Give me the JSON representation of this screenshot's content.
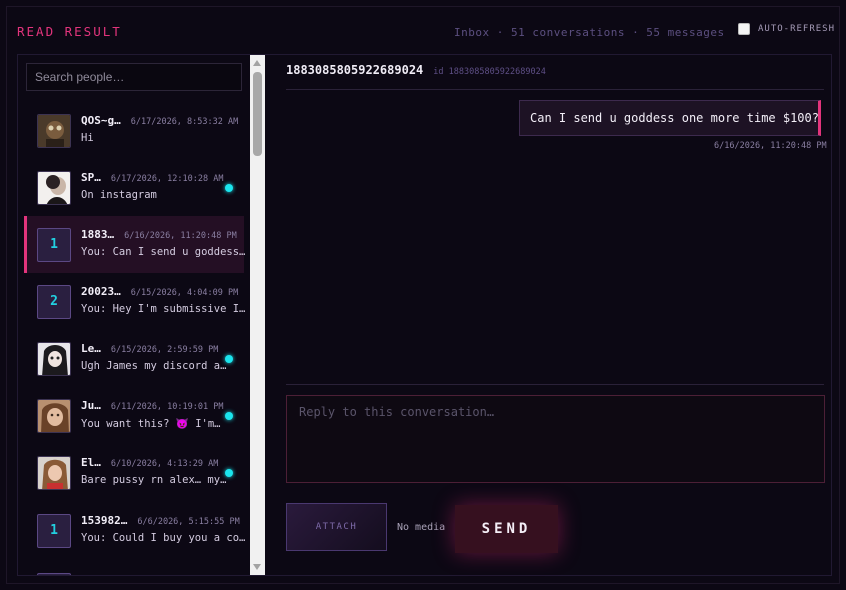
{
  "header": {
    "title": "READ RESULT",
    "stats": "Inbox · 51 conversations · 55 messages",
    "auto_refresh_label": "AUTO-REFRESH",
    "auto_refresh_checked": false
  },
  "sidebar": {
    "search_placeholder": "Search people…",
    "conversations": [
      {
        "name": "QOS~g…",
        "time": "6/17/2026, 8:53:32 AM",
        "preview": "Hi",
        "avatar": "photo",
        "unread": false,
        "active": false
      },
      {
        "name": "SP…",
        "time": "6/17/2026, 12:10:28 AM",
        "preview": "On instagram",
        "avatar": "photo",
        "unread": true,
        "active": false
      },
      {
        "name": "1883…",
        "time": "6/16/2026, 11:20:48 PM",
        "preview": "You: Can I send u goddess…",
        "avatar": "1",
        "unread": false,
        "active": true
      },
      {
        "name": "20023…",
        "time": "6/15/2026, 4:04:09 PM",
        "preview": "You: Hey I'm submissive I…",
        "avatar": "2",
        "unread": false,
        "active": false
      },
      {
        "name": "Le…",
        "time": "6/15/2026, 2:59:59 PM",
        "preview": "Ugh James my discord a…",
        "avatar": "photo",
        "unread": true,
        "active": false
      },
      {
        "name": "Ju…",
        "time": "6/11/2026, 10:19:01 PM",
        "preview": "You want this? 😈 I'm…",
        "avatar": "photo",
        "unread": true,
        "active": false
      },
      {
        "name": "El…",
        "time": "6/10/2026, 4:13:29 AM",
        "preview": "Bare pussy rn alex… my…",
        "avatar": "photo",
        "unread": true,
        "active": false
      },
      {
        "name": "153982…",
        "time": "6/6/2026, 5:15:55 PM",
        "preview": "You: Could I buy you a co…",
        "avatar": "1",
        "unread": false,
        "active": false
      }
    ]
  },
  "thread": {
    "title": "1883085805922689024",
    "subtitle": "id 1883085805922689024",
    "messages": [
      {
        "text": "Can I send u goddess one more time $100?",
        "time": "6/16/2026, 11:20:48 PM",
        "from": "me"
      }
    ]
  },
  "composer": {
    "placeholder": "Reply to this conversation…",
    "attach_label": "ATTACH",
    "media_status": "No media",
    "send_label": "SEND"
  },
  "colors": {
    "accent": "#e2347c",
    "unread": "#1be5ee",
    "background": "#0c0814"
  }
}
